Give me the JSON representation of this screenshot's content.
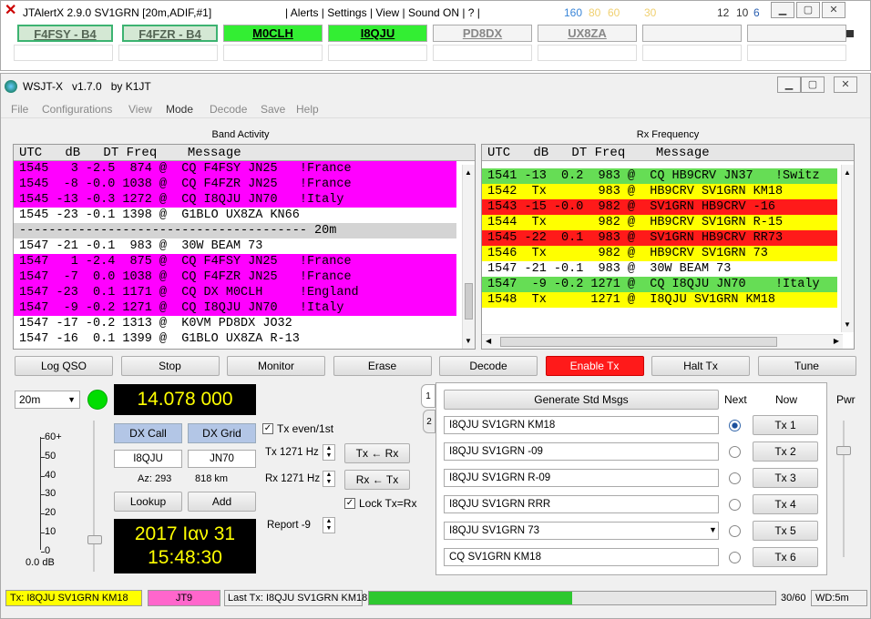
{
  "jtalert": {
    "title": "JTAlertX 2.9.0 SV1GRN [20m,ADIF,#1]",
    "menu": "| Alerts | Settings | View | Sound ON | ? |",
    "nums": [
      {
        "t": "160",
        "c": "#3a86d8"
      },
      {
        "t": "80",
        "c": "#f0d070"
      },
      {
        "t": "60",
        "c": "#f0d070"
      },
      {
        "t": "30",
        "c": "#f0d070"
      },
      {
        "t": "12",
        "c": "#333"
      },
      {
        "t": "10",
        "c": "#333"
      },
      {
        "t": "6",
        "c": "#2a5fb0"
      }
    ],
    "calls": [
      {
        "label": "F4FSY - B4",
        "bg": "#d4e8d4",
        "fg": "#556655",
        "border": "#3cb371"
      },
      {
        "label": "F4FZR - B4",
        "bg": "#d4e8d4",
        "fg": "#556655",
        "border": "#3cb371"
      },
      {
        "label": "M0CLH",
        "bg": "#33ee33",
        "fg": "#000",
        "border": "#aaa"
      },
      {
        "label": "I8QJU",
        "bg": "#33ee33",
        "fg": "#000",
        "border": "#aaa"
      },
      {
        "label": "PD8DX",
        "bg": "#f4f4f4",
        "fg": "#888",
        "border": "#aaa"
      },
      {
        "label": "UX8ZA",
        "bg": "#f4f4f4",
        "fg": "#888",
        "border": "#aaa"
      },
      {
        "label": "",
        "bg": "#f4f4f4",
        "fg": "#888",
        "border": "#aaa"
      },
      {
        "label": "",
        "bg": "#f4f4f4",
        "fg": "#888",
        "border": "#aaa"
      }
    ]
  },
  "wsjt": {
    "title": "WSJT-X   v1.7.0   by K1JT",
    "menu": [
      "File",
      "Configurations",
      "View",
      "Mode",
      "Decode",
      "Save",
      "Help"
    ],
    "band": {
      "title": "Band Activity",
      "header": "UTC   dB   DT Freq    Message",
      "rows": [
        {
          "t": "1545   3 -2.5  874 @  CQ F4FSY JN25   !France",
          "bg": "#ff00ff"
        },
        {
          "t": "1545  -8 -0.0 1038 @  CQ F4FZR JN25   !France",
          "bg": "#ff00ff"
        },
        {
          "t": "1545 -13 -0.3 1272 @  CQ I8QJU JN70   !Italy",
          "bg": "#ff00ff"
        },
        {
          "t": "1545 -23 -0.1 1398 @  G1BLO UX8ZA KN66",
          "bg": "#ffffff"
        },
        {
          "t": "--------------------------------------- 20m",
          "bg": "#d4d4d4"
        },
        {
          "t": "1547 -21 -0.1  983 @  30W BEAM 73",
          "bg": "#ffffff"
        },
        {
          "t": "1547   1 -2.4  875 @  CQ F4FSY JN25   !France",
          "bg": "#ff00ff"
        },
        {
          "t": "1547  -7  0.0 1038 @  CQ F4FZR JN25   !France",
          "bg": "#ff00ff"
        },
        {
          "t": "1547 -23  0.1 1171 @  CQ DX M0CLH     !England",
          "bg": "#ff00ff"
        },
        {
          "t": "1547  -9 -0.2 1271 @  CQ I8QJU JN70   !Italy",
          "bg": "#ff00ff"
        },
        {
          "t": "1547 -17 -0.2 1313 @  K0VM PD8DX JO32",
          "bg": "#ffffff"
        },
        {
          "t": "1547 -16  0.1 1399 @  G1BLO UX8ZA R-13",
          "bg": "#ffffff"
        }
      ]
    },
    "rx": {
      "title": "Rx Frequency",
      "header": "UTC   dB   DT Freq    Message",
      "rows": [
        {
          "t": "1541 -13  0.2  983 @  CQ HB9CRV JN37   !Switz",
          "bg": "#66dd55"
        },
        {
          "t": "1542  Tx       983 @  HB9CRV SV1GRN KM18",
          "bg": "#ffff00"
        },
        {
          "t": "1543 -15 -0.0  982 @  SV1GRN HB9CRV -16",
          "bg": "#ff1a1a"
        },
        {
          "t": "1544  Tx       982 @  HB9CRV SV1GRN R-15",
          "bg": "#ffff00"
        },
        {
          "t": "1545 -22  0.1  983 @  SV1GRN HB9CRV RR73",
          "bg": "#ff1a1a"
        },
        {
          "t": "1546  Tx       982 @  HB9CRV SV1GRN 73",
          "bg": "#ffff00"
        },
        {
          "t": "1547 -21 -0.1  983 @  30W BEAM 73",
          "bg": "#ffffff"
        },
        {
          "t": "1547  -9 -0.2 1271 @  CQ I8QJU JN70    !Italy",
          "bg": "#66dd55"
        },
        {
          "t": "1548  Tx      1271 @  I8QJU SV1GRN KM18",
          "bg": "#ffff00"
        }
      ]
    },
    "buttons": [
      "Log QSO",
      "Stop",
      "Monitor",
      "Erase",
      "Decode",
      "Enable Tx",
      "Halt Tx",
      "Tune"
    ],
    "band_select": "20m",
    "frequency": "14.078 000",
    "dx": {
      "call_label": "DX Call",
      "grid_label": "DX Grid",
      "call": "I8QJU",
      "grid": "JN70",
      "az": "Az: 293",
      "dist": "818 km",
      "lookup": "Lookup",
      "add": "Add"
    },
    "datetime": {
      "date": "2017 Iαν 31",
      "time": "15:48:30"
    },
    "meter": {
      "labels": [
        "60+",
        "50",
        "40",
        "30",
        "20",
        "10",
        "0"
      ],
      "db": "0.0 dB"
    },
    "tx_even": "Tx even/1st",
    "tx_hz": "Tx  1271 Hz",
    "rx_hz": "Rx  1271 Hz",
    "tx_from_rx": "Tx ← Rx",
    "rx_from_tx": "Rx ← Tx",
    "lock": "Lock Tx=Rx",
    "report": "Report -9",
    "msgs": {
      "generate": "Generate Std Msgs",
      "next": "Next",
      "now": "Now",
      "pwr": "Pwr",
      "tabs": [
        "1",
        "2"
      ],
      "list": [
        {
          "text": "I8QJU SV1GRN KM18",
          "tx": "Tx 1"
        },
        {
          "text": "I8QJU SV1GRN -09",
          "tx": "Tx 2"
        },
        {
          "text": "I8QJU SV1GRN R-09",
          "tx": "Tx 3"
        },
        {
          "text": "I8QJU SV1GRN RRR",
          "tx": "Tx 4"
        },
        {
          "text": "I8QJU SV1GRN 73",
          "tx": "Tx 5"
        },
        {
          "text": "CQ SV1GRN KM18",
          "tx": "Tx 6"
        }
      ]
    },
    "status": {
      "tx": "Tx: I8QJU SV1GRN KM18",
      "mode": "JT9",
      "last": "Last Tx:  I8QJU SV1GRN KM18",
      "progress": "30/60",
      "progress_value": 0.5,
      "wd": "WD:5m"
    }
  }
}
